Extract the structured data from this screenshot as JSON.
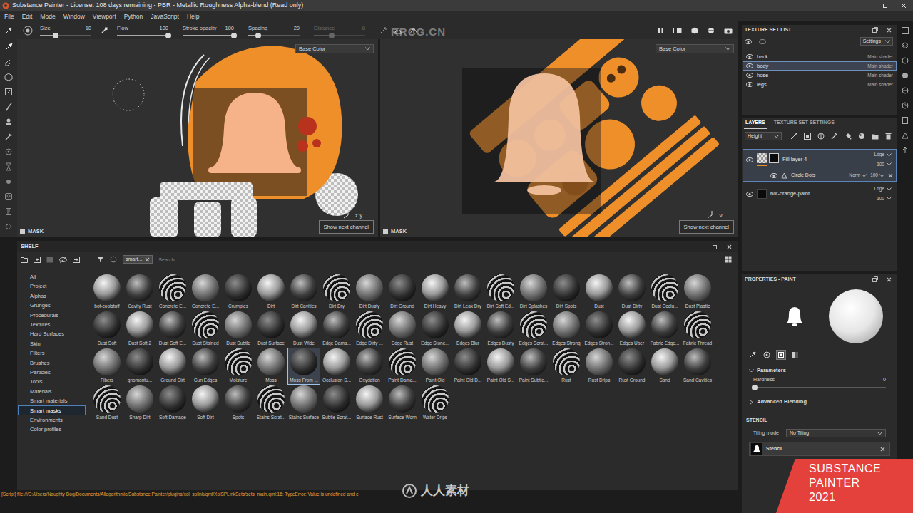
{
  "window": {
    "title": "Substance Painter - License: 108 days remaining - PBR - Metallic Roughness Alpha-blend (Read only)"
  },
  "menu": [
    "File",
    "Edit",
    "Mode",
    "Window",
    "Viewport",
    "Python",
    "JavaScript",
    "Help"
  ],
  "tool_options": [
    {
      "label": "Size",
      "value": "10",
      "level": 0.3,
      "disabled": false
    },
    {
      "label": "Flow",
      "value": "100",
      "level": 1,
      "disabled": false
    },
    {
      "label": "Stroke opacity",
      "value": "100",
      "level": 1,
      "disabled": false
    },
    {
      "label": "Spacing",
      "value": "20",
      "level": 0.2,
      "disabled": false
    },
    {
      "label": "Distance",
      "value": "8",
      "level": 0.35,
      "disabled": true
    }
  ],
  "viewports": [
    {
      "channel": "Base Color",
      "mask": "MASK",
      "button": "Show next channel",
      "axes": [
        "z",
        "y"
      ]
    },
    {
      "channel": "Base Color",
      "mask": "MASK",
      "button": "Show next channel",
      "axes": [
        "V"
      ]
    }
  ],
  "texture_set_list": {
    "title": "TEXTURE SET LIST",
    "settings": "Settings",
    "items": [
      {
        "name": "back",
        "shader": "Main shader",
        "selected": false,
        "visible": true
      },
      {
        "name": "body",
        "shader": "Main shader",
        "selected": true,
        "visible": true
      },
      {
        "name": "hose",
        "shader": "Main shader",
        "selected": false,
        "visible": true
      },
      {
        "name": "legs",
        "shader": "Main shader",
        "selected": false,
        "visible": true
      }
    ]
  },
  "layers": {
    "tabs": [
      {
        "label": "LAYERS",
        "selected": true
      },
      {
        "label": "TEXTURE SET SETTINGS",
        "selected": false
      }
    ],
    "channel": "Height",
    "rows": [
      {
        "name": "Fill layer 4",
        "blend": "Ldge",
        "opacity": "100",
        "selected": true,
        "visible": true,
        "kind": "fill",
        "effects": [
          {
            "name": "Circle Dots",
            "blend": "Norm",
            "opacity": "100",
            "visible": true
          }
        ]
      },
      {
        "name": "bot-orange-paint",
        "blend": "Ldge",
        "opacity": "100",
        "selected": false,
        "visible": true,
        "kind": "folder",
        "effects": []
      }
    ]
  },
  "properties": {
    "title": "PROPERTIES - PAINT",
    "tabs": [
      {
        "selected": false
      },
      {
        "selected": false
      },
      {
        "selected": true
      },
      {
        "selected": false
      }
    ],
    "parameters": "Parameters",
    "hardness": {
      "label": "Hardness",
      "value": "0",
      "level": 0
    },
    "advanced": "Advanced Blending",
    "stencil": {
      "title": "STENCIL",
      "tiling_label": "Tiling mode",
      "tiling_value": "No Tiling",
      "name": "Stencil"
    }
  },
  "shelf": {
    "title": "SHELF",
    "filter_chip": "smart...",
    "search_placeholder": "Search...",
    "categories": [
      {
        "label": "All",
        "selected": false
      },
      {
        "label": "Project",
        "selected": false
      },
      {
        "label": "Alphas",
        "selected": false
      },
      {
        "label": "Grunges",
        "selected": false
      },
      {
        "label": "Procedurals",
        "selected": false
      },
      {
        "label": "Textures",
        "selected": false
      },
      {
        "label": "Hard Surfaces",
        "selected": false
      },
      {
        "label": "Skin",
        "selected": false
      },
      {
        "label": "Filters",
        "selected": false
      },
      {
        "label": "Brushes",
        "selected": false
      },
      {
        "label": "Particles",
        "selected": false
      },
      {
        "label": "Tools",
        "selected": false
      },
      {
        "label": "Materials",
        "selected": false
      },
      {
        "label": "Smart materials",
        "selected": false
      },
      {
        "label": "Smart masks",
        "selected": true
      },
      {
        "label": "Environments",
        "selected": false
      },
      {
        "label": "Color profiles",
        "selected": false
      }
    ],
    "items": [
      {
        "label": "bot-coolstuff",
        "selected": false
      },
      {
        "label": "Cavity Rust",
        "selected": false
      },
      {
        "label": "Concrete E...",
        "selected": false
      },
      {
        "label": "Concrete E...",
        "selected": false
      },
      {
        "label": "Crumples",
        "selected": false
      },
      {
        "label": "Dirt",
        "selected": false
      },
      {
        "label": "Dirt Cavities",
        "selected": false
      },
      {
        "label": "Dirt Dry",
        "selected": false
      },
      {
        "label": "Dirt Dusty",
        "selected": false
      },
      {
        "label": "Dirt Ground",
        "selected": false
      },
      {
        "label": "Dirt Heavy",
        "selected": false
      },
      {
        "label": "Dirt Leak Dry",
        "selected": false
      },
      {
        "label": "Dirt Soft Ed...",
        "selected": false
      },
      {
        "label": "Dirt Splashes",
        "selected": false
      },
      {
        "label": "Dirt Spots",
        "selected": false
      },
      {
        "label": "Dust",
        "selected": false
      },
      {
        "label": "Dust Dirty",
        "selected": false
      },
      {
        "label": "Dust Occlu...",
        "selected": false
      },
      {
        "label": "Dust Plastic",
        "selected": false
      },
      {
        "label": "Dust Soft",
        "selected": false
      },
      {
        "label": "Dust Soft 2",
        "selected": false
      },
      {
        "label": "Dust Soft E...",
        "selected": false
      },
      {
        "label": "Dust Stained",
        "selected": false
      },
      {
        "label": "Dust Subtle",
        "selected": false
      },
      {
        "label": "Dust Surface",
        "selected": false
      },
      {
        "label": "Dust Wide",
        "selected": false
      },
      {
        "label": "Edge Dama...",
        "selected": false
      },
      {
        "label": "Edge Dirty ...",
        "selected": false
      },
      {
        "label": "Edge Rust",
        "selected": false
      },
      {
        "label": "Edge Stone...",
        "selected": false
      },
      {
        "label": "Edges Blur",
        "selected": false
      },
      {
        "label": "Edges Dusty",
        "selected": false
      },
      {
        "label": "Edges Scrat...",
        "selected": false
      },
      {
        "label": "Edges Strong",
        "selected": false
      },
      {
        "label": "Edges Stron...",
        "selected": false
      },
      {
        "label": "Edges Uber",
        "selected": false
      },
      {
        "label": "Fabric Edge...",
        "selected": false
      },
      {
        "label": "Fabric Thread",
        "selected": false
      },
      {
        "label": "Fibers",
        "selected": false
      },
      {
        "label": "gnomontu...",
        "selected": false
      },
      {
        "label": "Ground Dirt",
        "selected": false
      },
      {
        "label": "Gun Edges",
        "selected": false
      },
      {
        "label": "Moisture",
        "selected": false
      },
      {
        "label": "Moss",
        "selected": false
      },
      {
        "label": "Moss From ...",
        "selected": true
      },
      {
        "label": "Occlusion S...",
        "selected": false
      },
      {
        "label": "Oxydation",
        "selected": false
      },
      {
        "label": "Paint Dama...",
        "selected": false
      },
      {
        "label": "Paint Old",
        "selected": false
      },
      {
        "label": "Paint Old D...",
        "selected": false
      },
      {
        "label": "Paint Old S...",
        "selected": false
      },
      {
        "label": "Paint Subtle...",
        "selected": false
      },
      {
        "label": "Rust",
        "selected": false
      },
      {
        "label": "Rust Drips",
        "selected": false
      },
      {
        "label": "Rust Ground",
        "selected": false
      },
      {
        "label": "Sand",
        "selected": false
      },
      {
        "label": "Sand Cavities",
        "selected": false
      },
      {
        "label": "Sand Dust",
        "selected": false
      },
      {
        "label": "Sharp Dirt",
        "selected": false
      },
      {
        "label": "Soft Damage",
        "selected": false
      },
      {
        "label": "Soft Dirt",
        "selected": false
      },
      {
        "label": "Spots",
        "selected": false
      },
      {
        "label": "Stains Scrat...",
        "selected": false
      },
      {
        "label": "Stains Surface",
        "selected": false
      },
      {
        "label": "Subtle Scrat...",
        "selected": false
      },
      {
        "label": "Surface Rust",
        "selected": false
      },
      {
        "label": "Surface Worn",
        "selected": false
      },
      {
        "label": "Water Drips",
        "selected": false
      }
    ]
  },
  "status_bar": "[Script] file:///C:/Users/Naughty Dog/Documents/Allegorithmic/Substance Painter/plugins/xol_splink/qml/XolSPLinkSets/sets_main.qml:16: TypeError: Value is undefined and c",
  "watermarks": [
    "RRCG.CN",
    "人人素材"
  ],
  "badge": [
    "SUBSTANCE",
    "PAINTER",
    "2021"
  ]
}
